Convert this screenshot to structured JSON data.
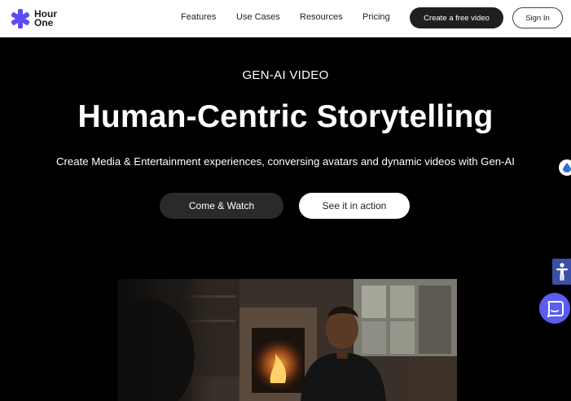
{
  "brand": {
    "name_line1": "Hour",
    "name_line2": "One",
    "color": "#5b4cf5"
  },
  "nav": {
    "items": [
      {
        "label": "Features"
      },
      {
        "label": "Use Cases"
      },
      {
        "label": "Resources"
      },
      {
        "label": "Pricing"
      }
    ],
    "cta_label": "Create a free video",
    "signin_label": "Sign In"
  },
  "hero": {
    "eyebrow": "GEN-AI VIDEO",
    "title": "Human-Centric Storytelling",
    "subtitle": "Create Media & Entertainment experiences, conversing avatars and dynamic videos with Gen-AI",
    "primary_button": "Come & Watch",
    "secondary_button": "See it in action"
  },
  "widgets": {
    "accessibility_color": "#3c4fa6",
    "chat_color": "#5b5cf0"
  }
}
